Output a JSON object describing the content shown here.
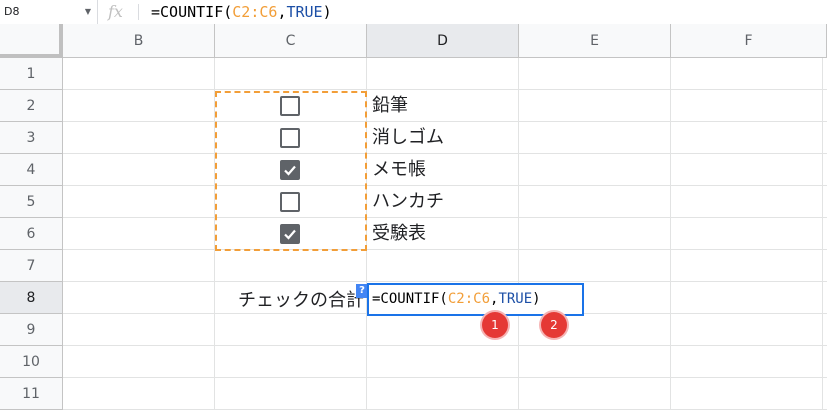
{
  "formula_bar": {
    "cell_ref": "D8",
    "fx_label": "fx",
    "formula_prefix": "=COUNTIF(",
    "formula_range": "C2:C6",
    "formula_comma": ",",
    "formula_true": "TRUE",
    "formula_close": ")"
  },
  "columns": [
    "B",
    "C",
    "D",
    "E",
    "F"
  ],
  "rows": [
    "1",
    "2",
    "3",
    "4",
    "5",
    "6",
    "7",
    "8",
    "9",
    "10",
    "11"
  ],
  "items": [
    {
      "label": "鉛筆",
      "checked": false
    },
    {
      "label": "消しゴム",
      "checked": false
    },
    {
      "label": "メモ帳",
      "checked": true
    },
    {
      "label": "ハンカチ",
      "checked": false
    },
    {
      "label": "受験表",
      "checked": true
    }
  ],
  "total_label": "チェックの合計",
  "editor": {
    "prefix": "=COUNTIF(",
    "range": "C2:C6",
    "comma": ",",
    "true_val": "TRUE",
    "close": ")",
    "help_glyph": "?"
  },
  "callouts": [
    "1",
    "2"
  ],
  "colors": {
    "range": "#f29e38",
    "true_token": "#1c4fa6",
    "selection": "#1a73e8",
    "callout": "#e53935"
  }
}
